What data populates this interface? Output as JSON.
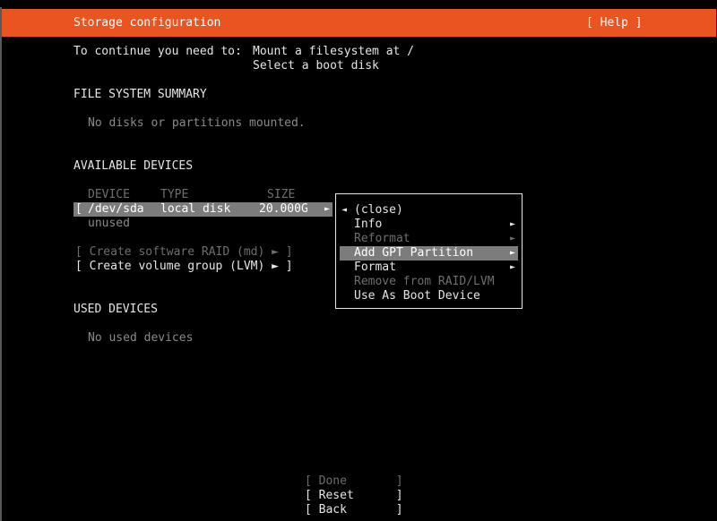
{
  "header": {
    "title": "Storage configuration",
    "help": "[ Help ]"
  },
  "instructions": {
    "prefix": "To continue you need to:",
    "line1": "Mount a filesystem at /",
    "line2": "Select a boot disk"
  },
  "fs_summary": {
    "heading": "FILE SYSTEM SUMMARY",
    "empty": "No disks or partitions mounted."
  },
  "available": {
    "heading": "AVAILABLE DEVICES",
    "col_device": "DEVICE",
    "col_type": "TYPE",
    "col_size": "SIZE",
    "row": {
      "bracket": "[",
      "device": "/dev/sda",
      "type": "local disk",
      "size": "20.000G",
      "arrow": "►"
    },
    "row_status": "unused",
    "raid": "[ Create software RAID (md) ► ]",
    "lvm": "[ Create volume group (LVM) ► ]"
  },
  "popup": {
    "close_arrow": "◄",
    "items": [
      {
        "label": "(close)",
        "arrow": ""
      },
      {
        "label": "Info",
        "arrow": "►"
      },
      {
        "label": "Reformat",
        "arrow": "►"
      },
      {
        "label": "Add GPT Partition",
        "arrow": "►"
      },
      {
        "label": "Format",
        "arrow": "►"
      },
      {
        "label": "Remove from RAID/LVM",
        "arrow": ""
      },
      {
        "label": "Use As Boot Device",
        "arrow": ""
      }
    ]
  },
  "used": {
    "heading": "USED DEVICES",
    "empty": "No used devices"
  },
  "buttons": {
    "done": "[ Done       ]",
    "reset": "[ Reset      ]",
    "back": "[ Back       ]"
  }
}
